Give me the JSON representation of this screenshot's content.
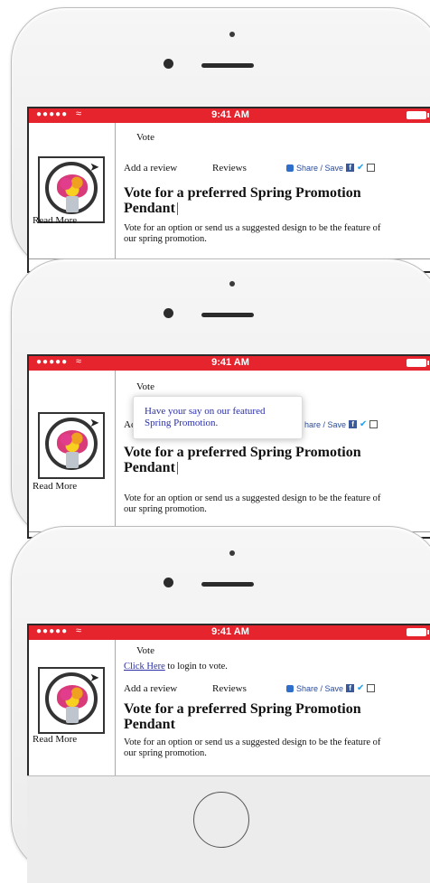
{
  "status": {
    "signal": "●●●●●",
    "wifi": "ᯤ",
    "time": "9:41 AM"
  },
  "left": {
    "read_more": "Read More"
  },
  "vote": {
    "label": "Vote"
  },
  "actions": {
    "add_review": "Add a review",
    "reviews": "Reviews"
  },
  "share": {
    "label": "Share / Save",
    "fb": "f",
    "tw": "🐦"
  },
  "poll": {
    "title": "Vote for a preferred Spring Promotion Pendant",
    "title_partial": "Vote for a preferred Spring Promotion",
    "title_line2": "Pendant",
    "description": "Vote for an option or send us a suggested design to be the feature of our spring promotion."
  },
  "tooltip": {
    "text": "Have your say on our featured Spring Promotion."
  },
  "login": {
    "link": "Click Here",
    "rest": " to login to vote."
  },
  "colors": {
    "status_bar": "#e5242e",
    "link": "#2a2fa8"
  }
}
